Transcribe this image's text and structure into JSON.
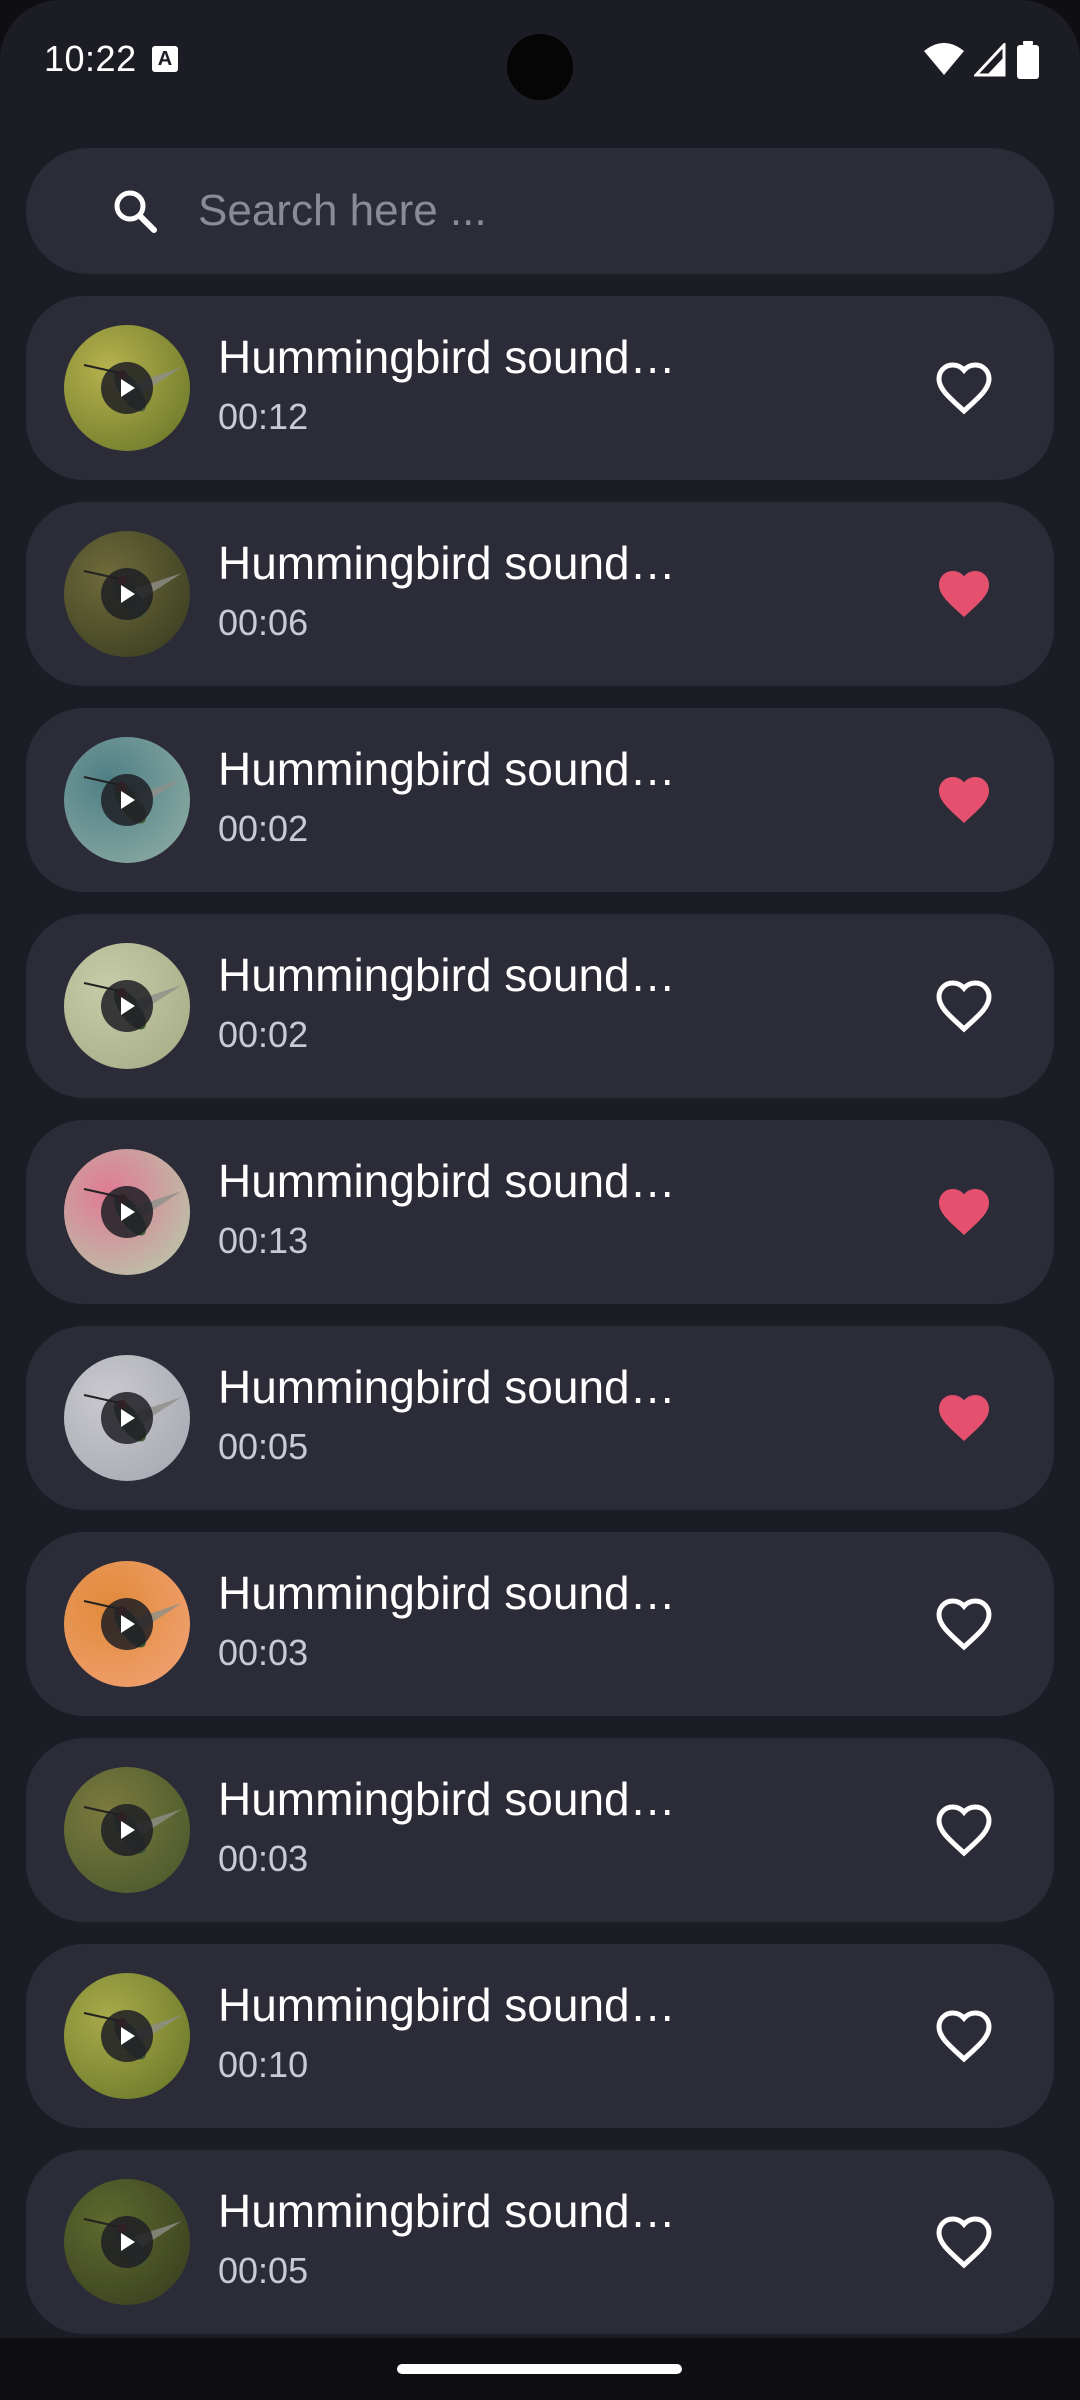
{
  "status_bar": {
    "time": "10:22",
    "notification_icon": "a-icon",
    "icons": [
      "wifi-icon",
      "signal-icon",
      "battery-icon"
    ]
  },
  "search": {
    "placeholder": "Search here ...",
    "icon": "search-icon"
  },
  "colors": {
    "background": "#1c1d24",
    "card": "#2b2c38",
    "favorite_active": "#e5506e",
    "text_primary": "#ffffff",
    "text_secondary": "#c9cad3"
  },
  "sounds": [
    {
      "title": "Hummingbird sound…",
      "duration": "00:12",
      "favorite": false,
      "thumb": [
        "#b7b24e",
        "#6d7a2a"
      ]
    },
    {
      "title": "Hummingbird sound…",
      "duration": "00:06",
      "favorite": true,
      "thumb": [
        "#6e6a3a",
        "#3c3f22"
      ]
    },
    {
      "title": "Hummingbird sound…",
      "duration": "00:02",
      "favorite": true,
      "thumb": [
        "#4e7f86",
        "#8aa9a1"
      ]
    },
    {
      "title": "Hummingbird sound…",
      "duration": "00:02",
      "favorite": false,
      "thumb": [
        "#c6cca8",
        "#a8ae88"
      ]
    },
    {
      "title": "Hummingbird sound…",
      "duration": "00:13",
      "favorite": true,
      "thumb": [
        "#e07a94",
        "#b9c4a8"
      ]
    },
    {
      "title": "Hummingbird sound…",
      "duration": "00:05",
      "favorite": true,
      "thumb": [
        "#c9c9cf",
        "#a9aab2"
      ]
    },
    {
      "title": "Hummingbird sound…",
      "duration": "00:03",
      "favorite": false,
      "thumb": [
        "#e08a3a",
        "#f0a070"
      ]
    },
    {
      "title": "Hummingbird sound…",
      "duration": "00:03",
      "favorite": false,
      "thumb": [
        "#7b7a3e",
        "#4b5a2c"
      ]
    },
    {
      "title": "Hummingbird sound…",
      "duration": "00:10",
      "favorite": false,
      "thumb": [
        "#a8aa4a",
        "#6d7a2a"
      ]
    },
    {
      "title": "Hummingbird sound…",
      "duration": "00:05",
      "favorite": false,
      "thumb": [
        "#5e6a2e",
        "#3a4020"
      ]
    }
  ]
}
